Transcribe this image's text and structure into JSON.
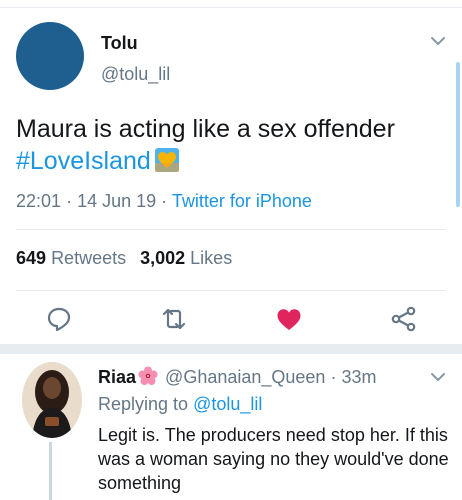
{
  "tweet": {
    "author_name": "Tolu",
    "author_handle": "@tolu_lil",
    "text_main": "Maura is acting like a sex offender",
    "hashtag": "#LoveIsland",
    "time": "22:01",
    "date": "14 Jun 19",
    "separator": "·",
    "source": "Twitter for iPhone",
    "retweets_count": "649",
    "retweets_label": "Retweets",
    "likes_count": "3,002",
    "likes_label": "Likes",
    "liked": true
  },
  "reply": {
    "author_name": "Riaa",
    "author_handle": "@Ghanaian_Queen",
    "age": "33m",
    "separator": "·",
    "replying_prefix": "Replying to",
    "replying_to": "@tolu_lil",
    "text": "Legit is. The producers need stop her. If this was a woman saying no they would've done something"
  },
  "colors": {
    "accent": "#1b95e0",
    "like": "#e0245e",
    "muted": "#657786",
    "avatar": "#1f5f90"
  },
  "icons": [
    "chevron-down-icon",
    "reply-icon",
    "retweet-icon",
    "heart-icon",
    "share-icon",
    "yellow-heart-emoji",
    "hibiscus-emoji"
  ]
}
